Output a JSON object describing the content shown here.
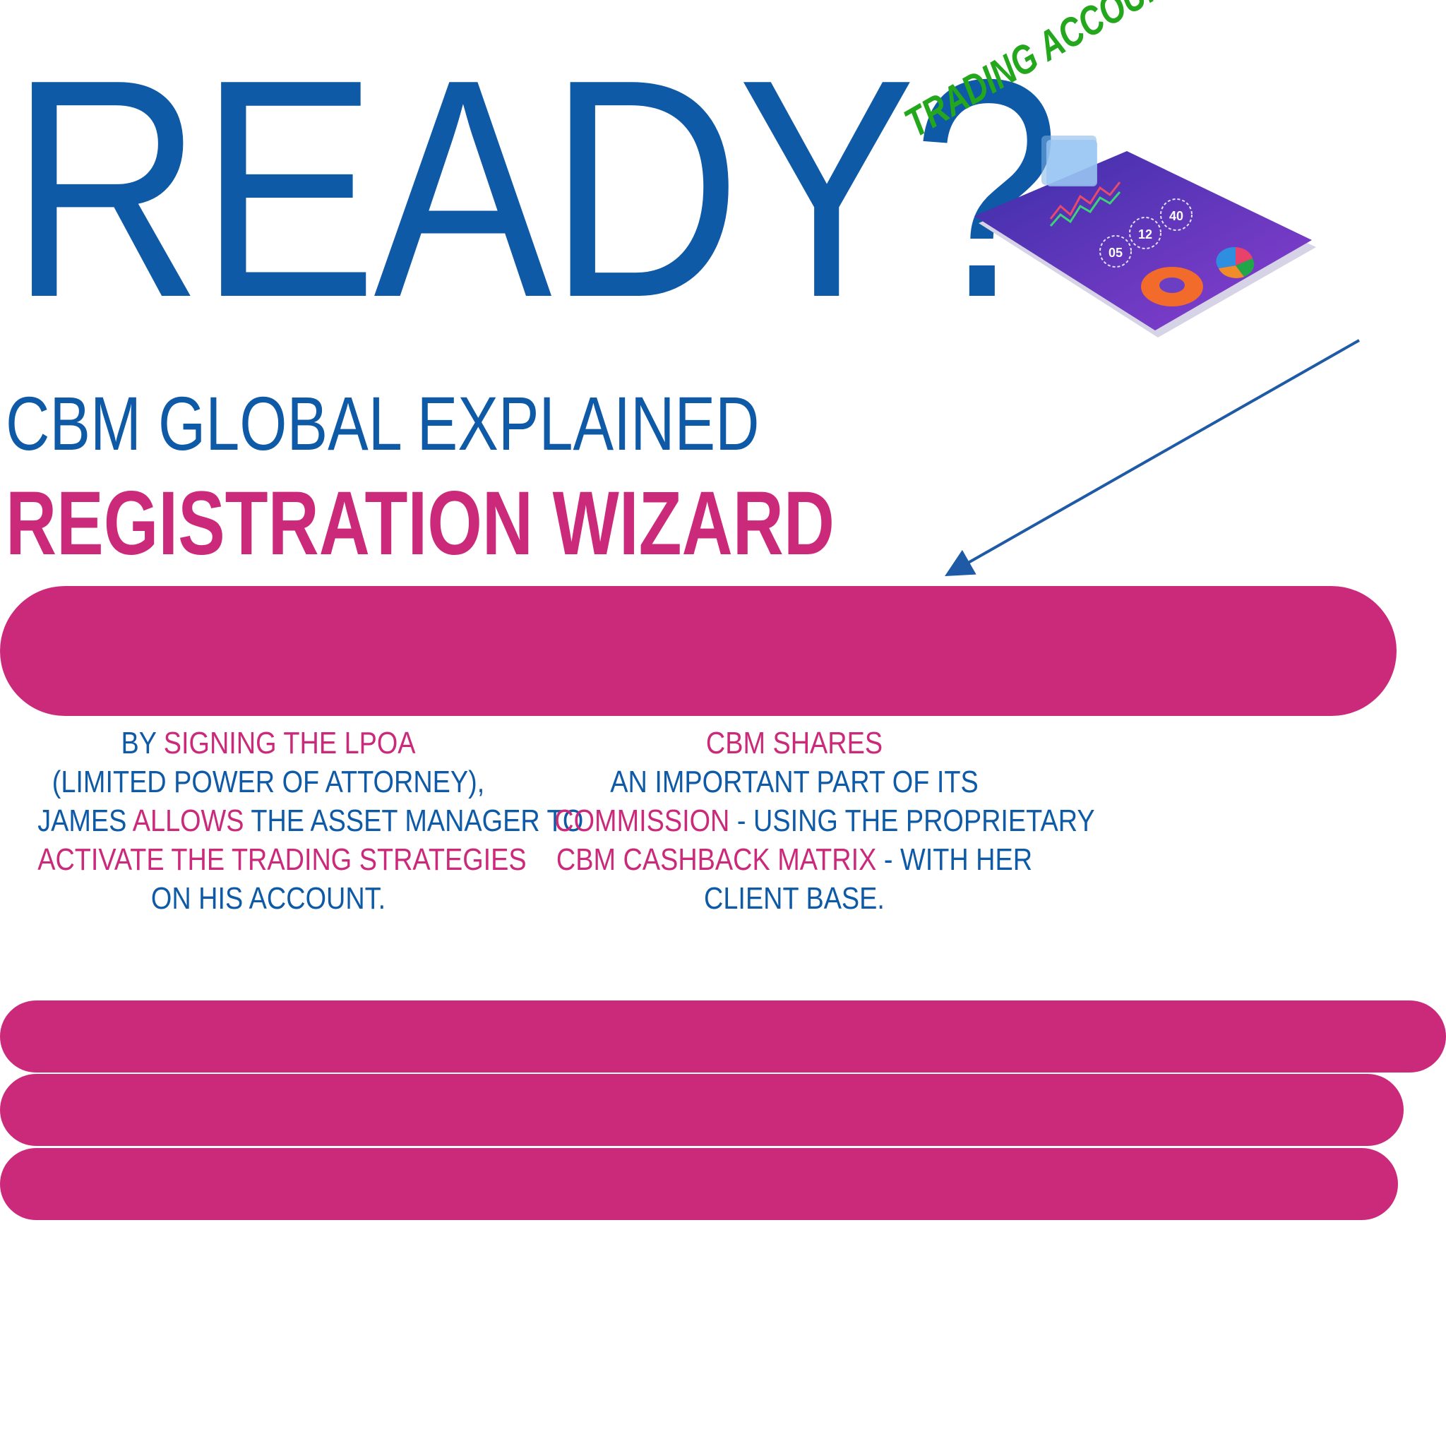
{
  "hero": {
    "headline": "READY?"
  },
  "illustration": {
    "label": "TRADING ACCOUNT",
    "dial_values": [
      "05",
      "12",
      "40"
    ]
  },
  "titles": {
    "explained": "CBM GLOBAL EXPLAINED",
    "wizard": "REGISTRATION WIZARD"
  },
  "left_column": {
    "l1a": "BY ",
    "l1b": "SIGNING THE LPOA",
    "l2": "(LIMITED POWER OF ATTORNEY),",
    "l3a": "JAMES ",
    "l3b": "ALLOWS",
    "l3c": " THE ASSET MANAGER TO",
    "l4": "ACTIVATE THE TRADING STRATEGIES",
    "l5": "ON HIS ACCOUNT."
  },
  "right_column": {
    "l1": "CBM SHARES",
    "l2": "AN IMPORTANT PART OF ITS",
    "l3a": "COMMISSION",
    "l3b": " - USING THE PROPRIETARY",
    "l4a": "CBM CASHBACK MATRIX",
    "l4b": " - WITH HER",
    "l5": "CLIENT BASE."
  },
  "colors": {
    "brand_blue": "#0e5aa6",
    "brand_pink": "#cb2a7b",
    "label_green": "#25a71d"
  }
}
